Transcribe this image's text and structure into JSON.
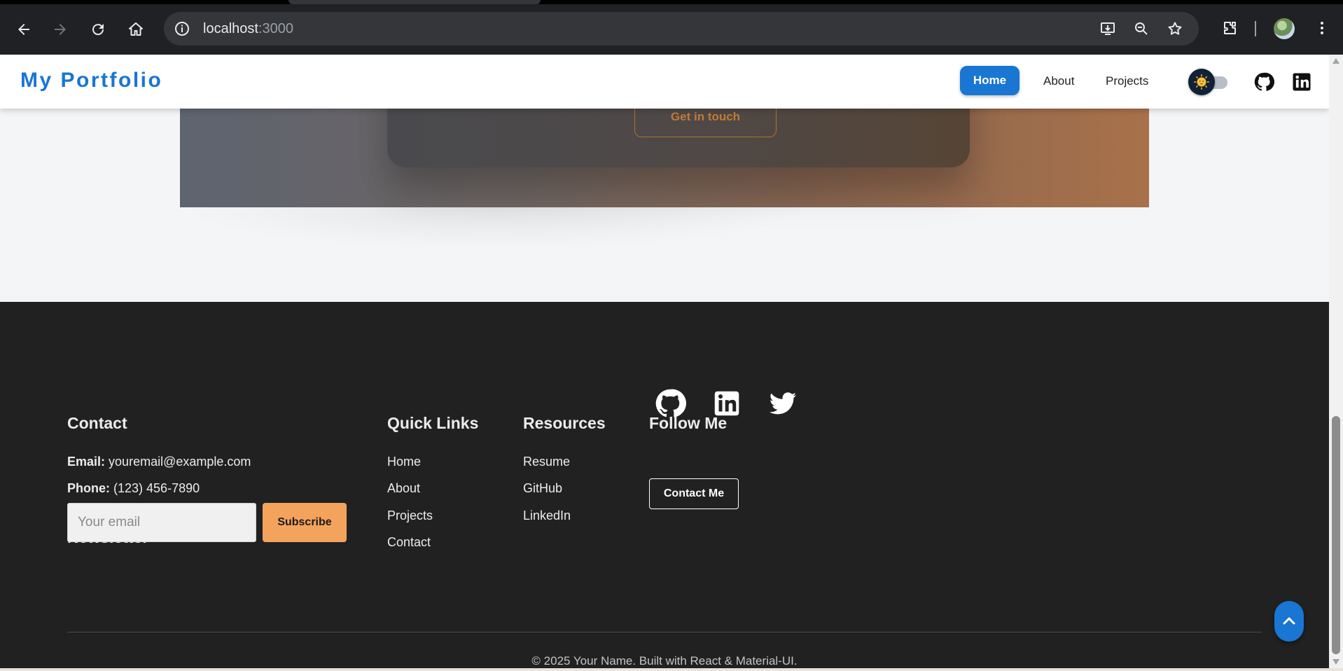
{
  "browser": {
    "url_host": "localhost",
    "url_port": ":3000",
    "icons": [
      "back-arrow-icon",
      "forward-arrow-icon",
      "reload-icon",
      "home-icon",
      "site-info-icon",
      "install-app-icon",
      "zoom-icon",
      "bookmark-star-icon",
      "extensions-icon",
      "profile-avatar",
      "kebab-menu-icon"
    ]
  },
  "navbar": {
    "brand": "My Portfolio",
    "links": {
      "home": "Home",
      "about": "About",
      "projects": "Projects"
    },
    "active": "Home",
    "accent_color": "#1976d2"
  },
  "hero": {
    "cta_label": "Get in touch"
  },
  "footer": {
    "contact": {
      "heading": "Contact",
      "email_label": "Email:",
      "email_value": "youremail@example.com",
      "phone_label": "Phone:",
      "phone_value": "(123) 456-7890"
    },
    "newsletter": {
      "heading": "Newsletter",
      "input_placeholder": "Your email",
      "input_value": "",
      "button_label": "Subscribe",
      "button_color": "#f4a35c"
    },
    "quick_links": {
      "heading": "Quick Links",
      "items": [
        "Home",
        "About",
        "Projects",
        "Contact"
      ]
    },
    "resources": {
      "heading": "Resources",
      "items": [
        "Resume",
        "GitHub",
        "LinkedIn"
      ]
    },
    "follow": {
      "heading": "Follow Me",
      "socials": [
        "github-icon",
        "linkedin-icon",
        "twitter-icon"
      ],
      "contact_button": "Contact Me"
    },
    "copyright": "© 2025 Your Name. Built with React & Material-UI.",
    "background": "#212121"
  }
}
